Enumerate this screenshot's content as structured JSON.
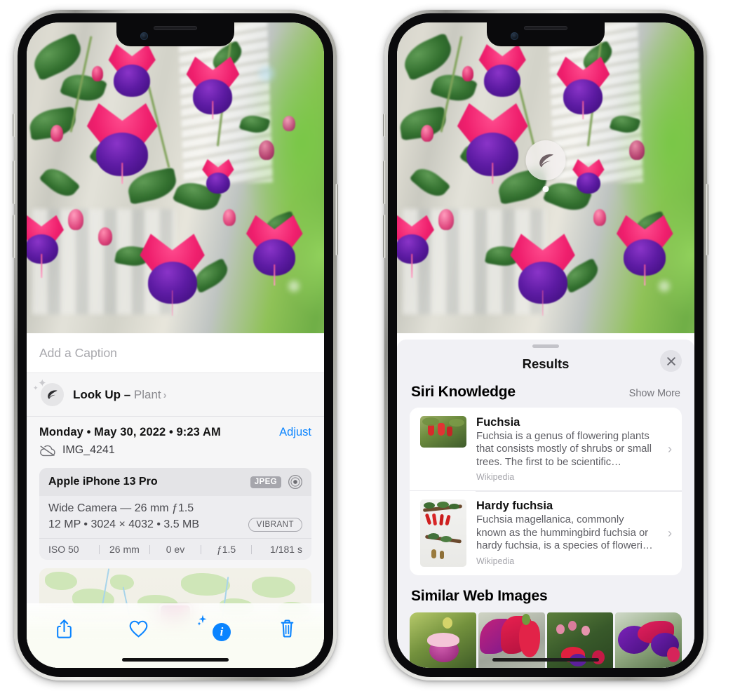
{
  "left_phone": {
    "photo": {
      "alt_name": "fuchsia-flowers-photo"
    },
    "caption": {
      "placeholder": "Add a Caption",
      "value": ""
    },
    "lookup_row": {
      "icon": "leaf-icon",
      "label": "Look Up – ",
      "subject": "Plant",
      "chevron": "›"
    },
    "metadata": {
      "date_line": "Monday • May 30, 2022 • 9:23 AM",
      "adjust_label": "Adjust",
      "cloud_icon": "icloud-slash-icon",
      "filename": "IMG_4241"
    },
    "camera_card": {
      "model": "Apple iPhone 13 Pro",
      "format_badge": "JPEG",
      "aperture_icon": "camera-aperture-icon",
      "lens_line": "Wide Camera — 26 mm ƒ1.5",
      "specs_line": "12 MP • 3024 × 4032 • 3.5 MB",
      "profile_badge": "VIBRANT",
      "exif": [
        "ISO 50",
        "26 mm",
        "0 ev",
        "ƒ1.5",
        "1/181 s"
      ]
    },
    "toolbar": [
      {
        "name": "share-button",
        "icon": "share-icon"
      },
      {
        "name": "favorite-button",
        "icon": "heart-icon"
      },
      {
        "name": "info-button",
        "icon": "info-sparkle-icon",
        "glyph": "i"
      },
      {
        "name": "delete-button",
        "icon": "trash-icon"
      }
    ]
  },
  "right_phone": {
    "lookup_pin": {
      "icon": "leaf-icon"
    },
    "sheet": {
      "title": "Results",
      "close_icon": "close-icon",
      "grabber": "sheet-grabber"
    },
    "siri_knowledge": {
      "title": "Siri Knowledge",
      "show_more": "Show More",
      "results": [
        {
          "title": "Fuchsia",
          "description": "Fuchsia is a genus of flowering plants that consists mostly of shrubs or small trees. The first to be scientific…",
          "source": "Wikipedia",
          "chevron": "›",
          "thumb": "fuchsia-red-flowers-thumbnail"
        },
        {
          "title": "Hardy fuchsia",
          "description": "Fuchsia magellanica, commonly known as the hummingbird fuchsia or hardy fuchsia, is a species of floweri…",
          "source": "Wikipedia",
          "chevron": "›",
          "thumb": "hardy-fuchsia-specimen-thumbnail"
        }
      ]
    },
    "similar_web_images": {
      "title": "Similar Web Images",
      "thumbs": [
        "fuchsia-pink-white-bloom",
        "fuchsia-red-closeup",
        "fuchsia-bush-buds",
        "fuchsia-purple-magenta-bloom"
      ]
    }
  },
  "colors": {
    "accent_blue": "#0a84ff",
    "sheet_bg": "#f1f1f5",
    "card_bg": "#ffffff",
    "muted_text": "#8b8b90"
  }
}
